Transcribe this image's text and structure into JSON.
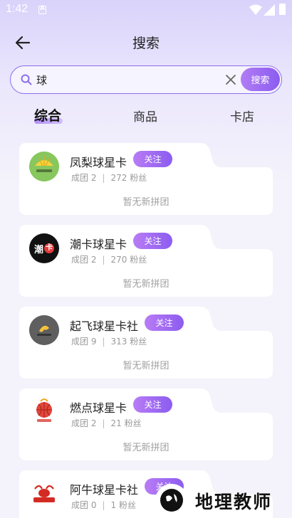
{
  "status_bar": {
    "time": "1:42",
    "notification_icon": "a-icon"
  },
  "header": {
    "title": "搜索"
  },
  "search": {
    "value": "球",
    "button_label": "搜索"
  },
  "tabs": [
    {
      "label": "综合",
      "active": true
    },
    {
      "label": "商品",
      "active": false
    },
    {
      "label": "卡店",
      "active": false
    }
  ],
  "shops": [
    {
      "name": "凤梨球星卡",
      "follow_label": "关注",
      "groups_label": "成团",
      "groups": "2",
      "fans": "272",
      "fans_label": "粉丝",
      "empty_note": "暂无新拼团"
    },
    {
      "name": "潮卡球星卡",
      "follow_label": "关注",
      "groups_label": "成团",
      "groups": "2",
      "fans": "270",
      "fans_label": "粉丝",
      "empty_note": "暂无新拼团",
      "avatar_text": [
        "潮",
        "卡"
      ]
    },
    {
      "name": "起飞球星卡社",
      "follow_label": "关注",
      "groups_label": "成团",
      "groups": "9",
      "fans": "313",
      "fans_label": "粉丝",
      "empty_note": "暂无新拼团"
    },
    {
      "name": "燃点球星卡",
      "follow_label": "关注",
      "groups_label": "成团",
      "groups": "2",
      "fans": "21",
      "fans_label": "粉丝",
      "empty_note": "暂无新拼团"
    },
    {
      "name": "阿牛球星卡社",
      "follow_label": "关注",
      "groups_label": "成团",
      "groups": "0",
      "fans": "1",
      "fans_label": "粉丝"
    }
  ],
  "watermark": {
    "text": "地理教师"
  },
  "colors": {
    "accent": "#8b5cf0",
    "accent_light": "#b87cf5",
    "background": "#f4f3fb"
  }
}
